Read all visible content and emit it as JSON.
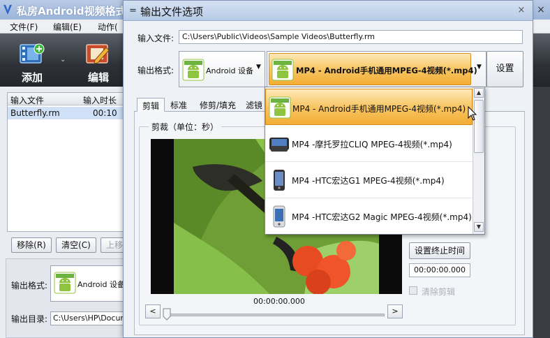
{
  "colors": {
    "accent_orange": "#f8c664",
    "title_blue": "#b8cbe8",
    "toolbar_dark": "#2e3238",
    "android_green": "#8fc43f"
  },
  "app": {
    "title": "私房Android视频格式",
    "menu": [
      "文件(F)",
      "编辑(E)",
      "动作("
    ],
    "toolbar": {
      "add_label": "添加",
      "edit_label": "编辑"
    },
    "file_list": {
      "columns": [
        "输入文件",
        "输入时长"
      ],
      "rows": [
        {
          "file": "Butterfly.rm",
          "duration": "00:10"
        }
      ]
    },
    "buttons": {
      "remove": "移除(R)",
      "clear": "清空(C)",
      "up": "上移"
    },
    "output_format_label": "输出格式:",
    "output_format_value": "Android 设备",
    "output_dir_label": "输出目录:",
    "output_dir_value": "C:\\Users\\HP\\Docume"
  },
  "dialog": {
    "title": "输出文件选项",
    "input_file_label": "输入文件:",
    "input_file_value": "C:\\Users\\Public\\Videos\\Sample Videos\\Butterfly.rm",
    "output_format_label": "输出格式:",
    "device_value": "Android 设备",
    "format_value": "MP4 - Android手机通用MPEG-4视频(*.mp4)",
    "settings_label": "设置",
    "tabs": [
      "剪辑",
      "标准",
      "修剪/填充",
      "滤镜"
    ],
    "crop_title": "剪裁（单位：秒）",
    "time_display": "00:00:00.000",
    "slider_left": "<",
    "slider_right": ">",
    "set_end_label": "设置终止时间",
    "end_time_value": "00:00:00.000",
    "clear_crop_label": "清除剪辑",
    "dropdown": [
      {
        "label": "MP4 - Android手机通用MPEG-4视频(*.mp4)",
        "icon": "android-icon",
        "selected": true
      },
      {
        "label": "MP4 -摩托罗拉CLIQ MPEG-4视频(*.mp4)",
        "icon": "phone-icon"
      },
      {
        "label": "MP4 -HTC宏达G1 MPEG-4视频(*.mp4)",
        "icon": "phone-icon"
      },
      {
        "label": "MP4 -HTC宏达G2 Magic  MPEG-4视频(*.mp4)",
        "icon": "phone-icon"
      }
    ]
  }
}
